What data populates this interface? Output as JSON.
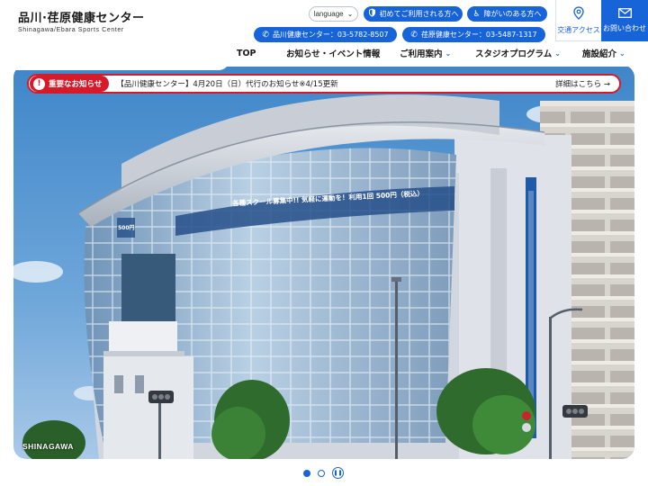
{
  "header": {
    "logo_jp": "品川·荏原健康センター",
    "logo_en": "Shinagawa/Ebara Sports Center",
    "language_label": "language",
    "first_time_label": "初めてご利用される方へ",
    "disability_label": "障がいのある方へ",
    "phone_shinagawa": "品川健康センター：03-5782-8507",
    "phone_ebara": "荏原健康センター：03-5487-1317",
    "access_label": "交通アクセス",
    "contact_label": "お問い合わせ"
  },
  "nav": {
    "items": [
      {
        "label": "TOP"
      },
      {
        "label": "お知らせ・イベント情報"
      },
      {
        "label": "ご利用案内"
      },
      {
        "label": "スタジオプログラム"
      },
      {
        "label": "施設紹介"
      }
    ]
  },
  "notice": {
    "badge": "重要なお知らせ",
    "text": "【品川健康センター】4月20日（日）代行のお知らせ※4/15更新",
    "more": "詳細はこちら"
  },
  "hero": {
    "caption": "SHINAGAWA",
    "banner_text": "各種スクール募集中!! 気軽に運動を！利用1回 500円（税込）",
    "side_text": "500円"
  },
  "colors": {
    "brand_blue": "#1763d8",
    "alert_red": "#d71a2a"
  },
  "icons": {
    "shield": "shield-icon",
    "wheelchair": "wheelchair-icon",
    "phone": "phone-icon",
    "location": "location-pin-icon",
    "mail": "mail-icon"
  }
}
